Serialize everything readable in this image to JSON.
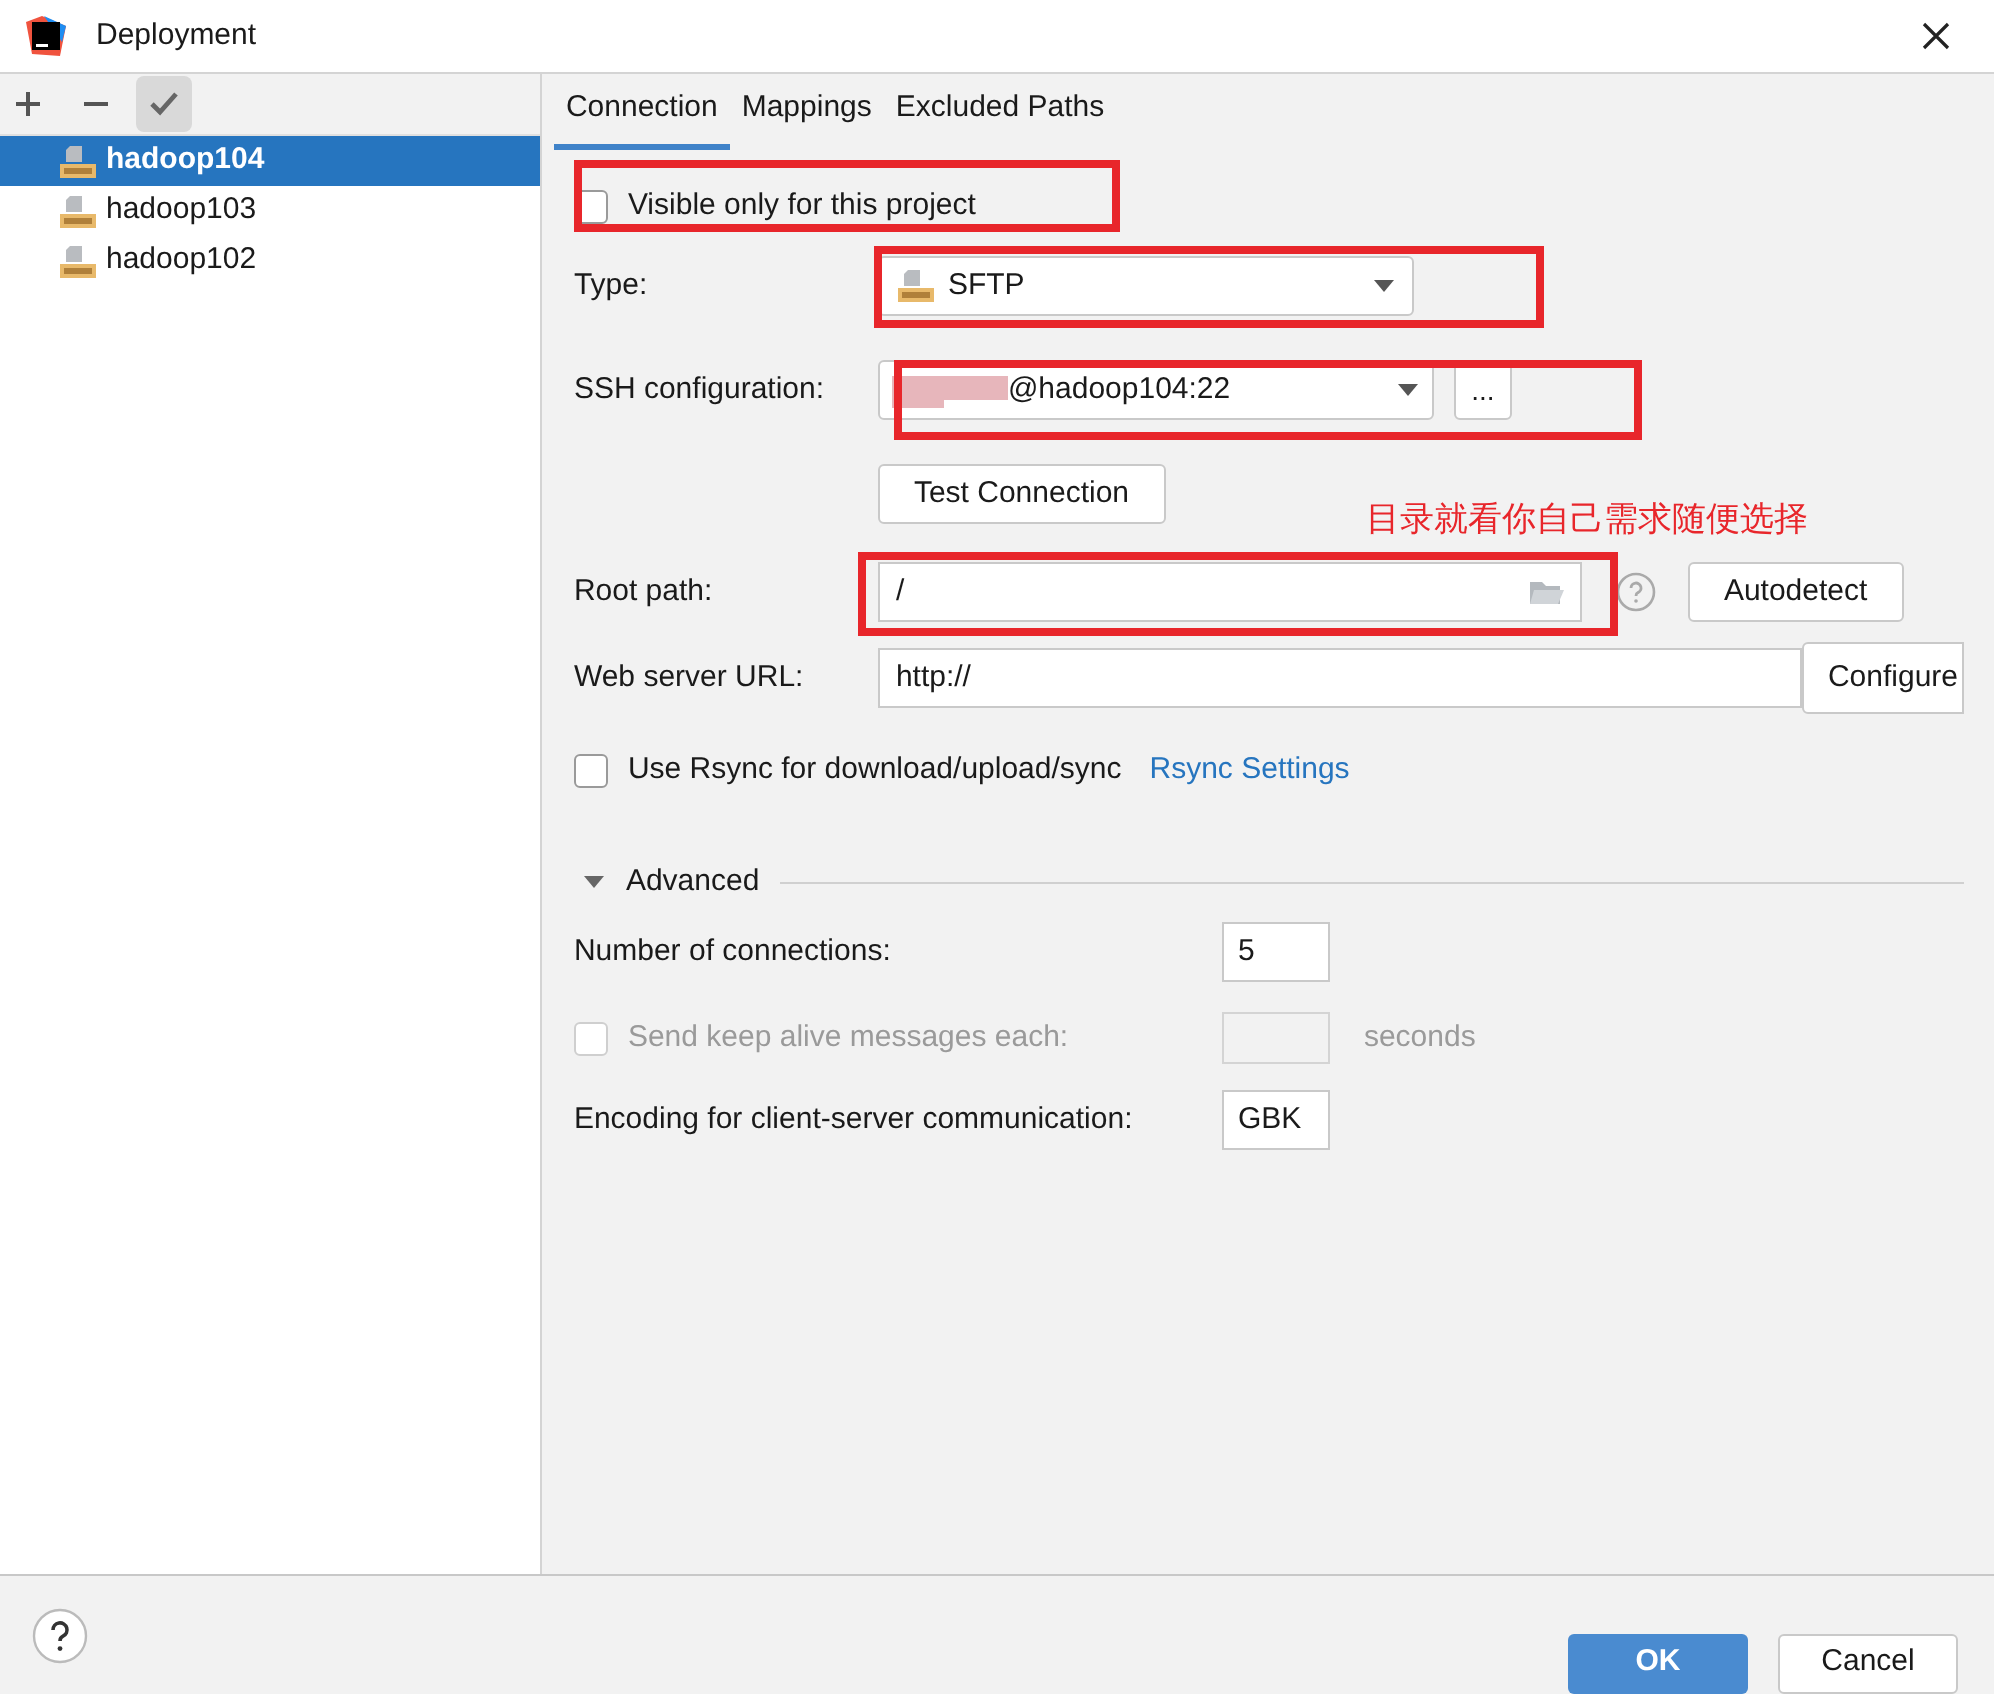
{
  "window": {
    "title": "Deployment"
  },
  "servers": [
    {
      "name": "hadoop104",
      "selected": true
    },
    {
      "name": "hadoop103",
      "selected": false
    },
    {
      "name": "hadoop102",
      "selected": false
    }
  ],
  "tabs": [
    {
      "label": "Connection",
      "selected": true
    },
    {
      "label": "Mappings",
      "selected": false
    },
    {
      "label": "Excluded Paths",
      "selected": false
    }
  ],
  "visible_only": {
    "label": "Visible only for this project",
    "checked": false
  },
  "type": {
    "label": "Type:",
    "value": "SFTP"
  },
  "ssh": {
    "label": "SSH configuration:",
    "value": "@hadoop104:22",
    "browse": "..."
  },
  "test_button": "Test Connection",
  "annotation": {
    "text": "目录就看你自己需求随便选择",
    "color": "#e8262b"
  },
  "root_path": {
    "label": "Root path:",
    "value": "/",
    "button": "Autodetect"
  },
  "web_url": {
    "label": "Web server URL:",
    "value": "http://",
    "button": "Configure"
  },
  "rsync": {
    "label": "Use Rsync for download/upload/sync",
    "checked": false,
    "link": "Rsync Settings"
  },
  "advanced": {
    "label": "Advanced",
    "expanded": true
  },
  "connections": {
    "label": "Number of connections:",
    "value": "5"
  },
  "keep_alive": {
    "label": "Send keep alive messages each:",
    "checked": false,
    "disabled": true,
    "unit": "seconds"
  },
  "encoding": {
    "label": "Encoding for client-server communication:",
    "value": "GBK"
  },
  "buttons": {
    "ok": "OK",
    "cancel": "Cancel"
  }
}
